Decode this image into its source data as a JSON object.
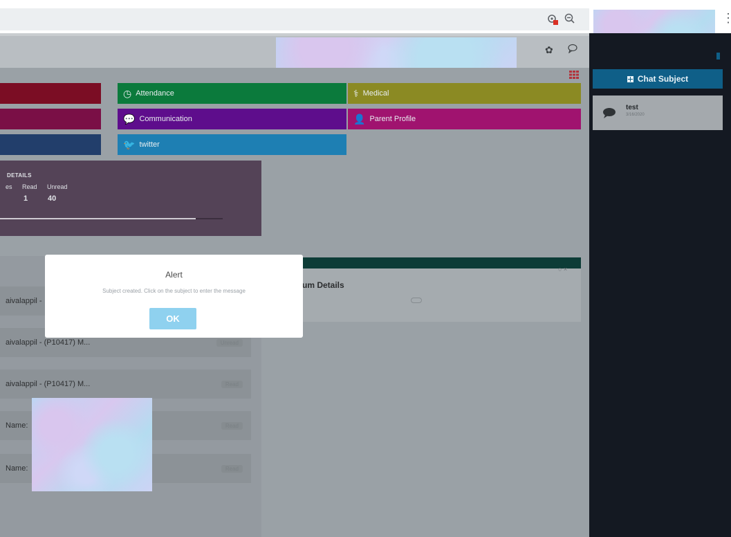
{
  "tiles": {
    "attendance": {
      "label": "Attendance",
      "color": "#0b7a3c"
    },
    "medical": {
      "label": "Medical",
      "color": "#8b8a23"
    },
    "communication": {
      "label": "Communication",
      "color": "#5e0d8c"
    },
    "parent_profile": {
      "label": "Parent Profile",
      "color": "#a0136f"
    },
    "twitter": {
      "label": "twitter",
      "color": "#1e7fb3"
    }
  },
  "message_details": {
    "title": "DETAILS",
    "columns": [
      "es",
      "Read",
      "Unread"
    ],
    "values": [
      "",
      "1",
      "40"
    ],
    "progress": 0.88
  },
  "curriculum": {
    "title": "um Details",
    "close": "○ ×"
  },
  "list": {
    "rows": [
      {
        "text": "aivalappil -",
        "badge": ""
      },
      {
        "text": "aivalappil - (P10417) M...",
        "badge": "Unread"
      },
      {
        "text": "aivalappil - (P10417) M...",
        "badge": "Read"
      },
      {
        "text": "Name:",
        "badge": "Read"
      },
      {
        "text": "Name:",
        "badge": "Read"
      }
    ]
  },
  "sidebar": {
    "chat_subject_label": "Chat Subject",
    "chat_item": {
      "title": "test",
      "date": "3/16/2020"
    }
  },
  "alert": {
    "title": "Alert",
    "message": "Subject created. Click on the subject to enter the message",
    "ok_label": "OK"
  }
}
